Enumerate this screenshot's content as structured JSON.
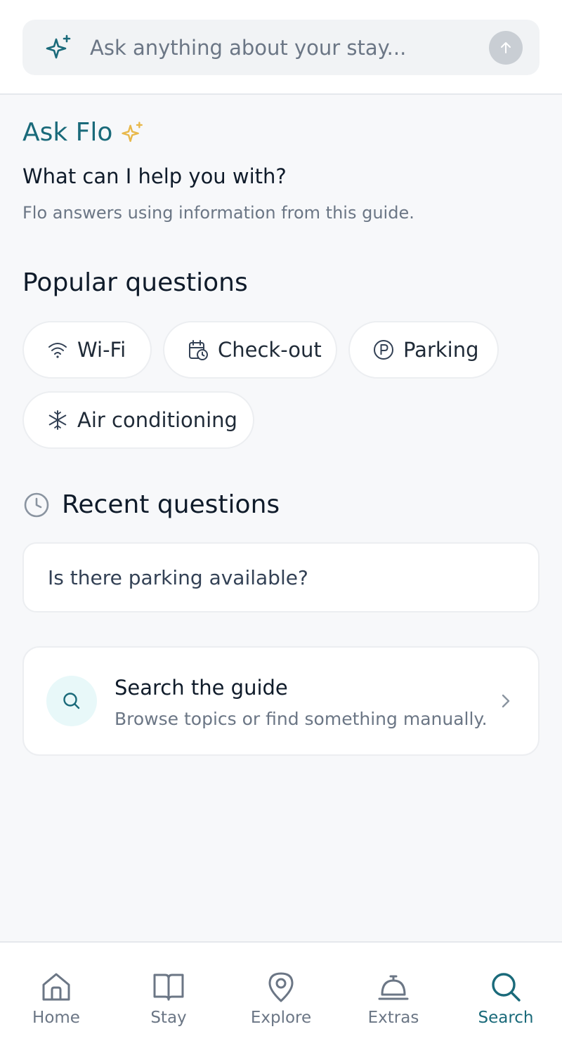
{
  "search": {
    "placeholder": "Ask anything about your stay..."
  },
  "header": {
    "title": "Ask Flo",
    "subtitle": "What can I help you with?",
    "helper": "Flo answers using information from this guide."
  },
  "popular": {
    "title": "Popular questions",
    "chips": [
      {
        "label": "Wi-Fi",
        "icon": "wifi-icon"
      },
      {
        "label": "Check-out",
        "icon": "calendar-clock-icon"
      },
      {
        "label": "Parking",
        "icon": "parking-icon"
      },
      {
        "label": "Air conditioning",
        "icon": "snowflake-icon"
      }
    ]
  },
  "recent": {
    "title": "Recent questions",
    "items": [
      {
        "label": "Is there parking available?"
      }
    ]
  },
  "guide": {
    "title": "Search the guide",
    "subtitle": "Browse topics or find something manually."
  },
  "nav": {
    "items": [
      {
        "label": "Home",
        "icon": "home-icon"
      },
      {
        "label": "Stay",
        "icon": "book-icon"
      },
      {
        "label": "Explore",
        "icon": "map-pin-icon"
      },
      {
        "label": "Extras",
        "icon": "service-bell-icon"
      },
      {
        "label": "Search",
        "icon": "search-icon"
      }
    ],
    "active": "Search"
  },
  "colors": {
    "accent": "#1a6a7a",
    "sparkle": "#e8b84a",
    "background": "#f7f8fa"
  }
}
